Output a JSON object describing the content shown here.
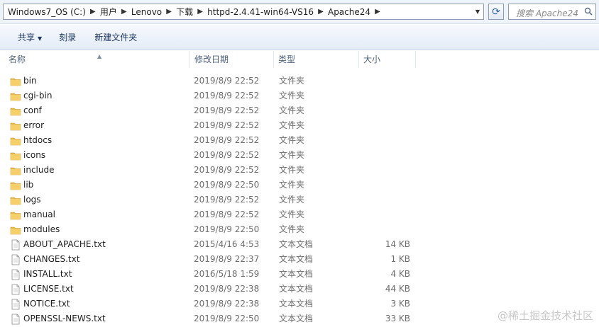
{
  "address": {
    "crumbs": [
      "Windows7_OS (C:)",
      "用户",
      "Lenovo",
      "下载",
      "httpd-2.4.41-win64-VS16",
      "Apache24"
    ]
  },
  "search": {
    "placeholder": "搜索 Apache24"
  },
  "toolbar": {
    "share_label": "共享",
    "burn_label": "刻录",
    "new_folder_label": "新建文件夹"
  },
  "columns": {
    "name": "名称",
    "modified": "修改日期",
    "type": "类型",
    "size": "大小"
  },
  "files": [
    {
      "name": "bin",
      "modified": "2019/8/9 22:52",
      "type": "文件夹",
      "size": "",
      "icon": "folder-icon"
    },
    {
      "name": "cgi-bin",
      "modified": "2019/8/9 22:52",
      "type": "文件夹",
      "size": "",
      "icon": "folder-icon"
    },
    {
      "name": "conf",
      "modified": "2019/8/9 22:52",
      "type": "文件夹",
      "size": "",
      "icon": "folder-icon"
    },
    {
      "name": "error",
      "modified": "2019/8/9 22:52",
      "type": "文件夹",
      "size": "",
      "icon": "folder-icon"
    },
    {
      "name": "htdocs",
      "modified": "2019/8/9 22:52",
      "type": "文件夹",
      "size": "",
      "icon": "folder-icon"
    },
    {
      "name": "icons",
      "modified": "2019/8/9 22:52",
      "type": "文件夹",
      "size": "",
      "icon": "folder-icon"
    },
    {
      "name": "include",
      "modified": "2019/8/9 22:52",
      "type": "文件夹",
      "size": "",
      "icon": "folder-icon"
    },
    {
      "name": "lib",
      "modified": "2019/8/9 22:50",
      "type": "文件夹",
      "size": "",
      "icon": "folder-icon"
    },
    {
      "name": "logs",
      "modified": "2019/8/9 22:52",
      "type": "文件夹",
      "size": "",
      "icon": "folder-icon"
    },
    {
      "name": "manual",
      "modified": "2019/8/9 22:52",
      "type": "文件夹",
      "size": "",
      "icon": "folder-icon"
    },
    {
      "name": "modules",
      "modified": "2019/8/9 22:50",
      "type": "文件夹",
      "size": "",
      "icon": "folder-icon"
    },
    {
      "name": "ABOUT_APACHE.txt",
      "modified": "2015/4/16 4:53",
      "type": "文本文档",
      "size": "14 KB",
      "icon": "text-file-icon"
    },
    {
      "name": "CHANGES.txt",
      "modified": "2019/8/9 22:37",
      "type": "文本文档",
      "size": "1 KB",
      "icon": "text-file-icon"
    },
    {
      "name": "INSTALL.txt",
      "modified": "2016/5/18 1:59",
      "type": "文本文档",
      "size": "4 KB",
      "icon": "text-file-icon"
    },
    {
      "name": "LICENSE.txt",
      "modified": "2019/8/9 22:38",
      "type": "文本文档",
      "size": "44 KB",
      "icon": "text-file-icon"
    },
    {
      "name": "NOTICE.txt",
      "modified": "2019/8/9 22:38",
      "type": "文本文档",
      "size": "3 KB",
      "icon": "text-file-icon"
    },
    {
      "name": "OPENSSL-NEWS.txt",
      "modified": "2019/8/9 22:50",
      "type": "文本文档",
      "size": "33 KB",
      "icon": "text-file-icon"
    }
  ],
  "watermark": "@稀土掘金技术社区",
  "colors": {
    "accent": "#2b5fa8",
    "folder": "#e8b84a"
  }
}
